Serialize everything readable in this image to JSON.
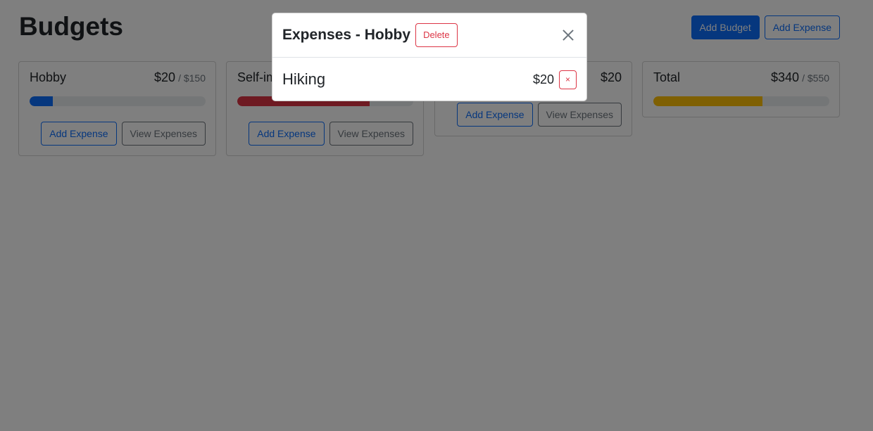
{
  "header": {
    "title": "Budgets",
    "add_budget_label": "Add Budget",
    "add_expense_label": "Add Expense"
  },
  "budgets": [
    {
      "name": "Hobby",
      "amount": "$20",
      "max": "/ $150",
      "progress": 0.133,
      "color": "#0d6efd",
      "add_label": "Add Expense",
      "view_label": "View Expenses"
    },
    {
      "name": "Self-improvement",
      "amount": "",
      "max": "",
      "progress": 0.75,
      "color": "#dc3545",
      "add_label": "Add Expense",
      "view_label": "View Expenses"
    },
    {
      "name": "",
      "amount": "$20",
      "max": "",
      "progress": null,
      "color": "#0d6efd",
      "add_label": "Add Expense",
      "view_label": "View Expenses"
    }
  ],
  "total": {
    "name": "Total",
    "amount": "$340",
    "max": "/ $550",
    "progress": 0.618,
    "color": "#ffc107"
  },
  "modal": {
    "title": "Expenses - Hobby",
    "delete_label": "Delete",
    "expenses": [
      {
        "description": "Hiking",
        "amount": "$20",
        "remove_label": "×"
      }
    ]
  }
}
